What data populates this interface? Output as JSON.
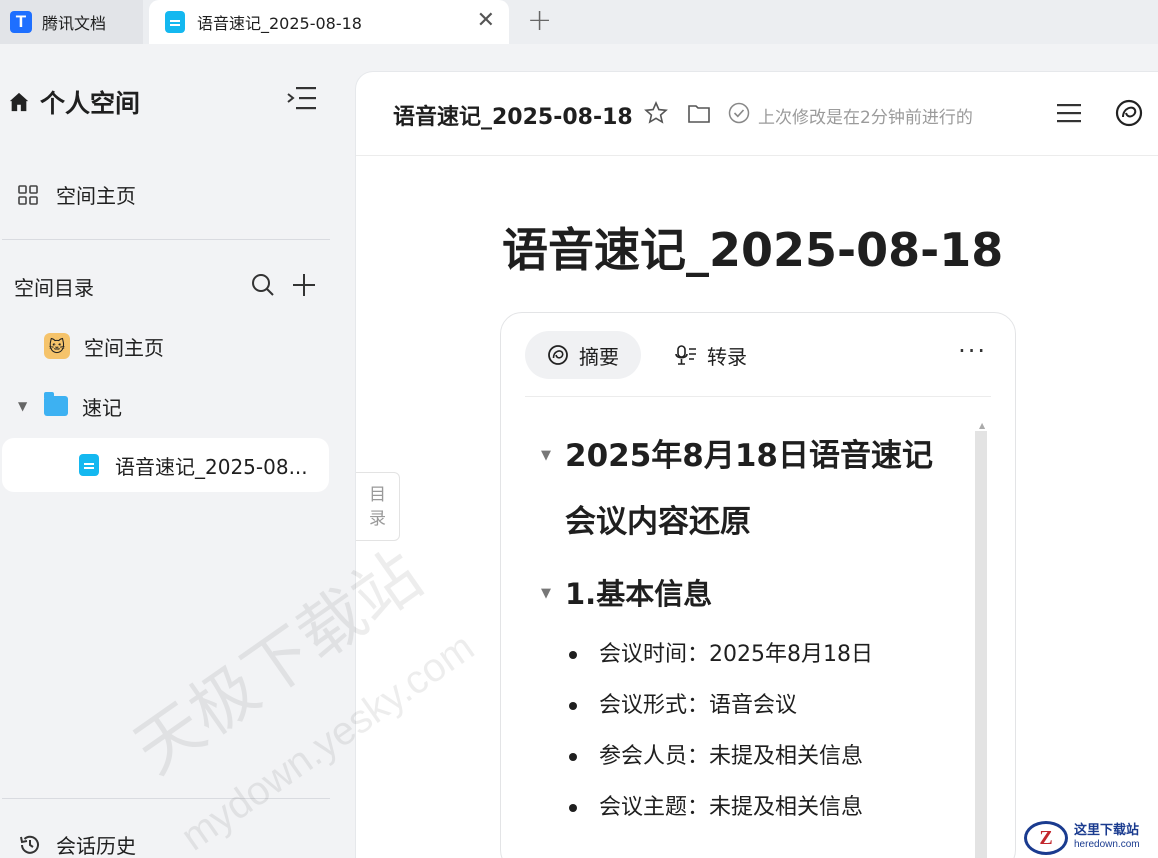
{
  "tabbar": {
    "app_name": "腾讯文档",
    "app_logo_letter": "T",
    "active_tab_title": "语音速记_2025-08-18",
    "close_symbol": "✕",
    "add_symbol": "+"
  },
  "sidebar": {
    "space_title": "个人空间",
    "space_home_label": "空间主页",
    "directory_label": "空间目录",
    "tree": [
      {
        "label": "空间主页",
        "icon": "emoji-avatar-icon"
      },
      {
        "label": "速记",
        "icon": "folder-icon",
        "expanded": true
      },
      {
        "label": "语音速记_2025-08...",
        "icon": "doc-icon",
        "selected": true
      }
    ],
    "history_label": "会话历史"
  },
  "header": {
    "doc_title": "语音速记_2025-08-18",
    "save_status": "上次修改是在2分钟前进行的"
  },
  "document": {
    "title": "语音速记_2025-08-18",
    "toc_label_1": "目",
    "toc_label_2": "录",
    "card": {
      "tabs": [
        {
          "label": "摘要",
          "icon": "ai-summary-icon",
          "active": true
        },
        {
          "label": "转录",
          "icon": "mic-transcript-icon",
          "active": false
        }
      ],
      "more_label": "···",
      "heading1": "2025年8月18日语音速记会议内容还原",
      "heading2": "1.基本信息",
      "bullets": [
        "会议时间：2025年8月18日",
        "会议形式：语音会议",
        "参会人员：未提及相关信息",
        "会议主题：未提及相关信息"
      ]
    }
  },
  "watermark": {
    "cn": "天极下载站",
    "url": "mydown.yesky.com"
  },
  "badge": {
    "logo_letter": "Z",
    "cn": "这里下载站",
    "en": "heredown.com"
  },
  "colors": {
    "accent_blue": "#1e6fff",
    "doc_icon": "#14b8f0",
    "folder": "#3db1f2",
    "sidebar_bg": "#f2f3f5"
  }
}
